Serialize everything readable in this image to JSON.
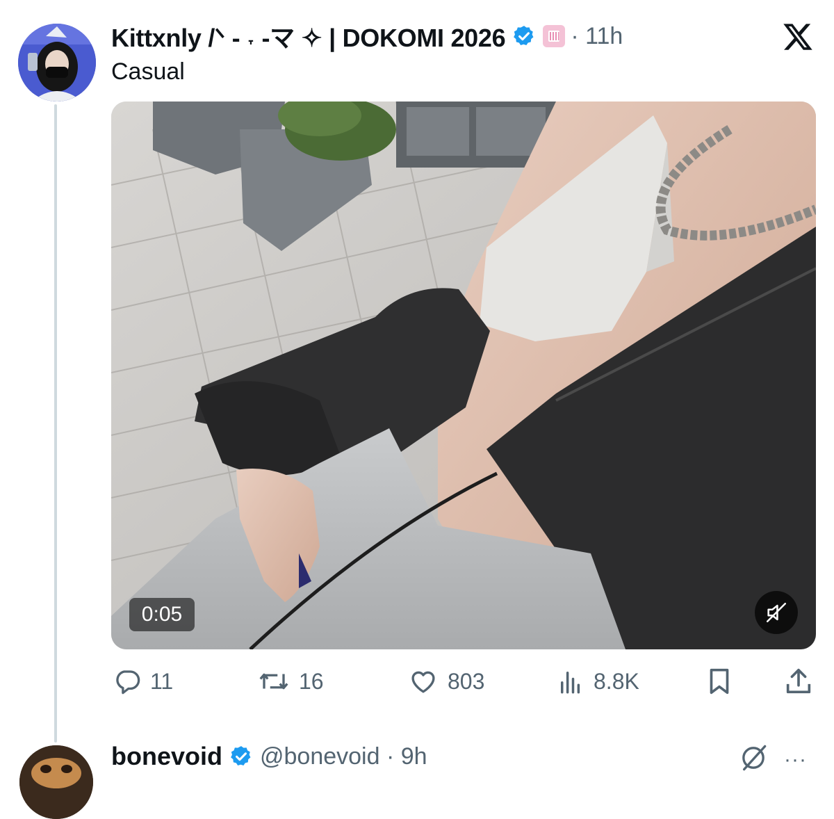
{
  "post": {
    "display_name": "Kittxnly /ᐠ - ˕ -マ ✧ | DOKOMI 2026",
    "time": "· 11h",
    "text": "Casual",
    "video_duration": "0:05",
    "stats": {
      "replies": "11",
      "reposts": "16",
      "likes": "803",
      "views": "8.8K"
    }
  },
  "reply": {
    "display_name": "bonevoid",
    "handle_time": "@bonevoid · 9h",
    "more_label": "···"
  },
  "colors": {
    "verified_blue": "#1d9bf0",
    "secondary_text": "#536471",
    "thread_line": "#cfd9de",
    "badge_pink": "#f4c2d6"
  },
  "icons": {
    "close": "x-logo-icon",
    "reply": "speech-bubble-icon",
    "repost": "repost-arrows-icon",
    "like": "heart-icon",
    "views": "bar-chart-icon",
    "bookmark": "bookmark-icon",
    "share": "share-upload-icon",
    "mute": "muted-speaker-icon"
  }
}
